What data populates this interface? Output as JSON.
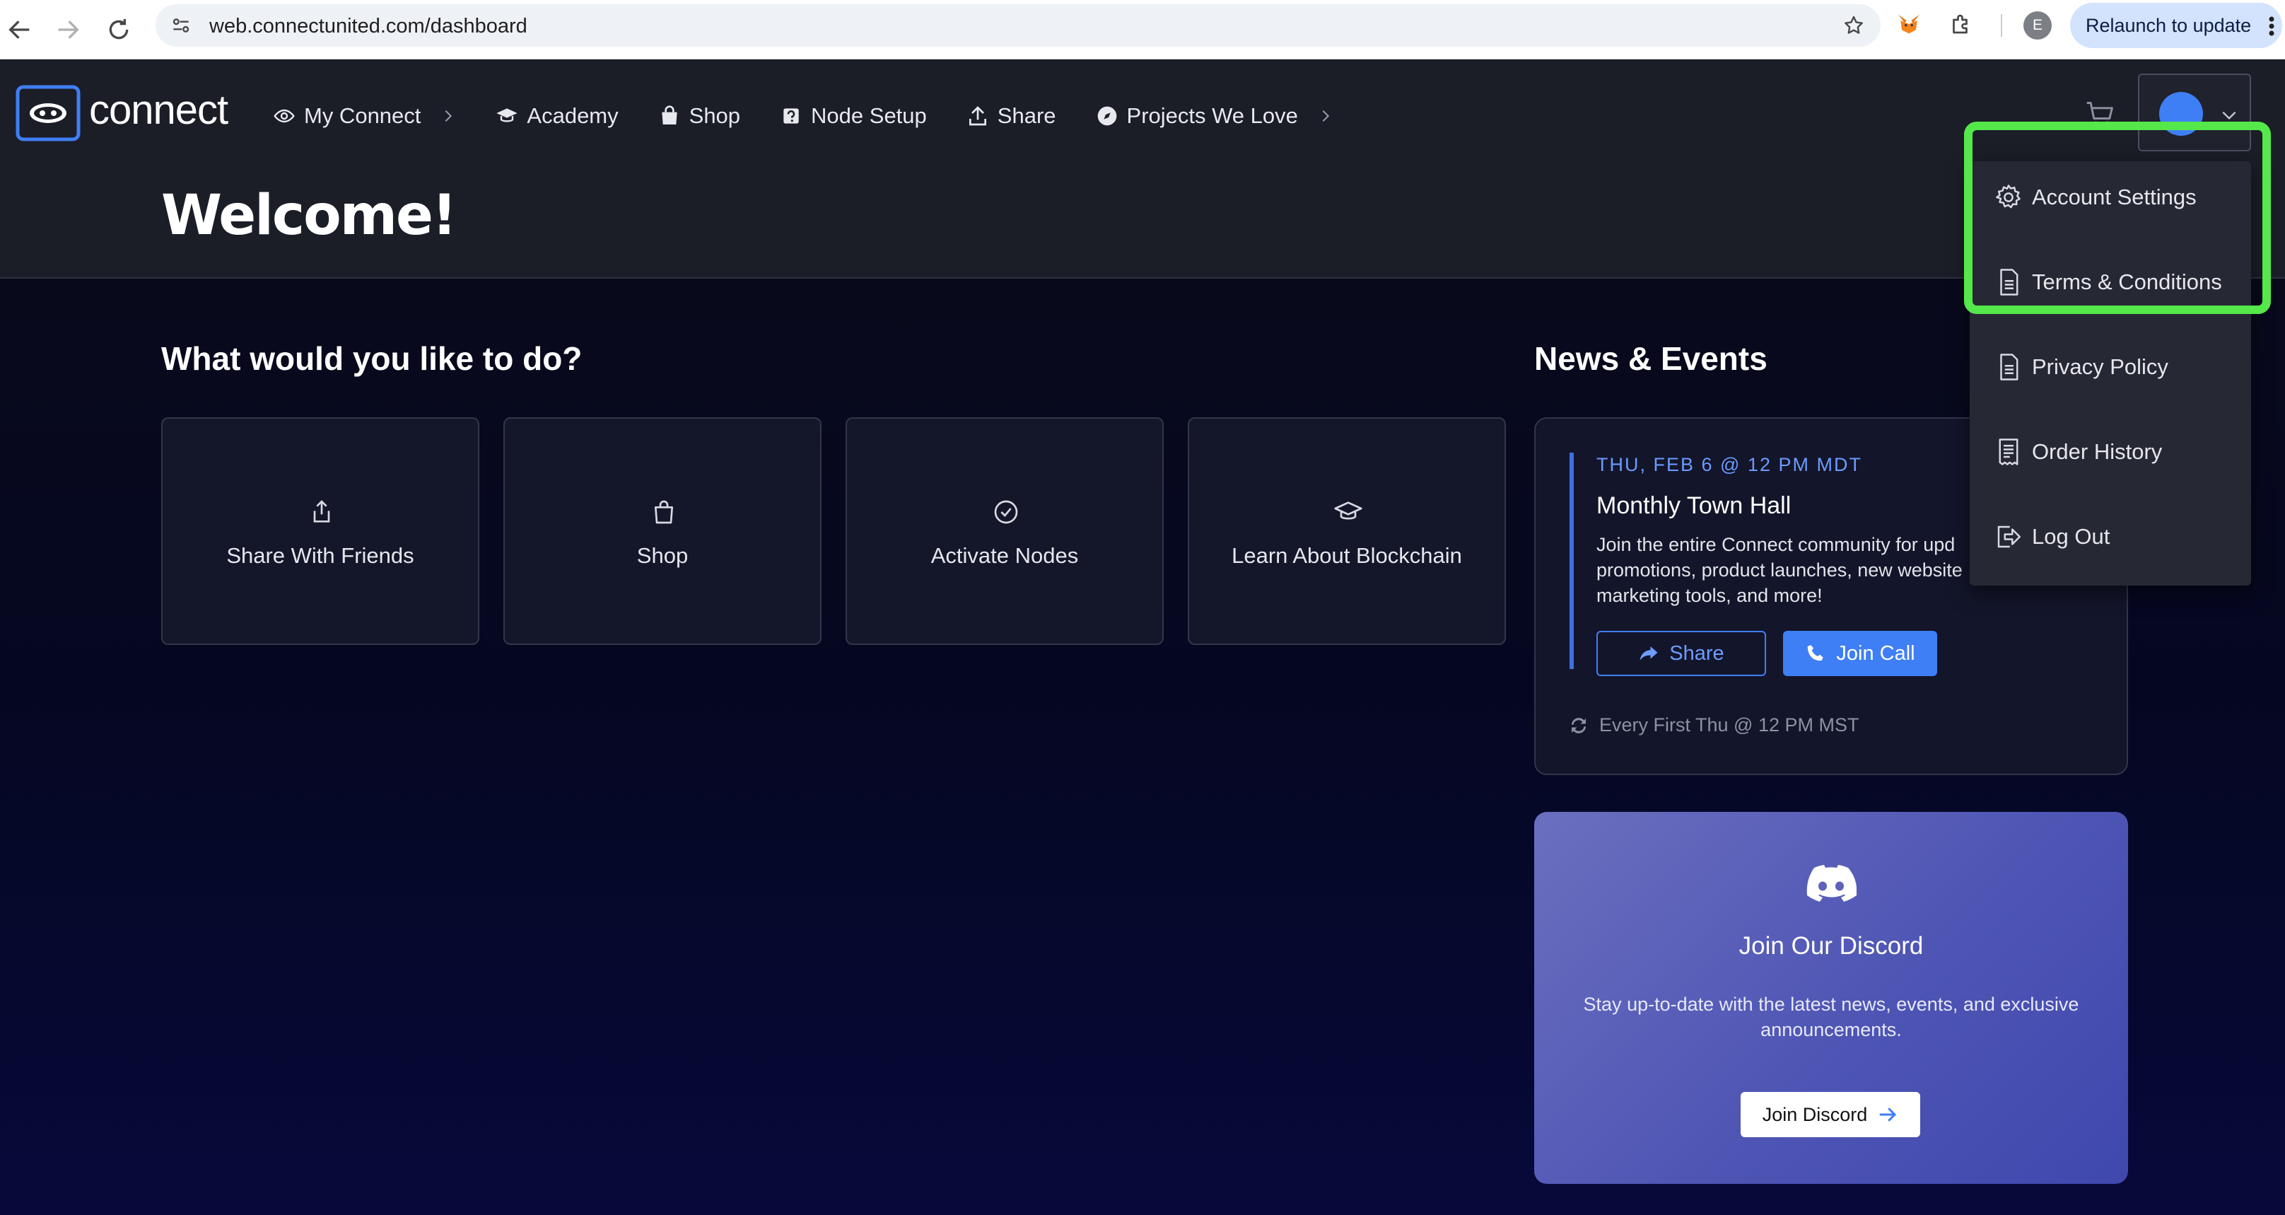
{
  "browser": {
    "url": "web.connectunited.com/dashboard",
    "profile_initial": "E",
    "relaunch_label": "Relaunch to update"
  },
  "app": {
    "logo_text": "connect",
    "nav": [
      {
        "label": "My Connect",
        "icon": "eye-icon",
        "has_chevron": true
      },
      {
        "label": "Academy",
        "icon": "graduation-cap-icon",
        "has_chevron": false
      },
      {
        "label": "Shop",
        "icon": "shopping-bag-icon",
        "has_chevron": false
      },
      {
        "label": "Node Setup",
        "icon": "node-icon",
        "has_chevron": false
      },
      {
        "label": "Share",
        "icon": "upload-icon",
        "has_chevron": false
      },
      {
        "label": "Projects We Love",
        "icon": "compass-icon",
        "has_chevron": true
      }
    ],
    "page_title": "Welcome!"
  },
  "account_menu": {
    "items": [
      {
        "label": "Account Settings",
        "icon": "gear-icon"
      },
      {
        "label": "Terms & Conditions",
        "icon": "document-icon"
      },
      {
        "label": "Privacy Policy",
        "icon": "document-icon"
      },
      {
        "label": "Order History",
        "icon": "receipt-icon"
      },
      {
        "label": "Log Out",
        "icon": "logout-icon"
      }
    ],
    "highlight_color": "#54e84a"
  },
  "actions": {
    "title": "What would you like to do?",
    "cards": [
      {
        "label": "Share With Friends",
        "icon": "share-upload-icon"
      },
      {
        "label": "Shop",
        "icon": "shopping-bag-icon"
      },
      {
        "label": "Activate Nodes",
        "icon": "check-circle-icon"
      },
      {
        "label": "Learn About Blockchain",
        "icon": "graduation-cap-icon"
      }
    ]
  },
  "news": {
    "title": "News & Events",
    "event": {
      "date": "THU, FEB 6 @ 12 PM MDT",
      "title": "Monthly Town Hall",
      "description_lines": [
        "Join the entire Connect community for upd",
        "promotions, product launches, new website",
        "marketing tools, and more!"
      ],
      "share_label": "Share",
      "join_label": "Join Call",
      "recurrence": "Every First Thu @ 12 PM MST"
    },
    "discord": {
      "title": "Join Our Discord",
      "description": "Stay up-to-date with the latest news, events, and exclusive announcements.",
      "button_label": "Join Discord"
    }
  },
  "colors": {
    "accent_blue": "#3f7ff5",
    "topbar_bg": "#1b1d27",
    "discord_purple": "#5058b8"
  }
}
